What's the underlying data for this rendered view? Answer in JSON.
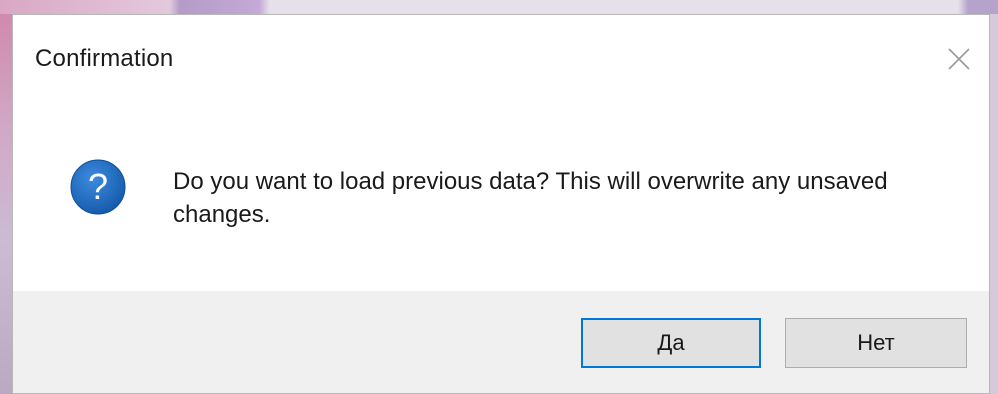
{
  "dialog": {
    "title": "Confirmation",
    "message": "Do you want to load previous data? This will overwrite any unsaved changes.",
    "icon": "question-icon",
    "buttons": {
      "yes_label": "Да",
      "no_label": "Нет"
    }
  },
  "colors": {
    "icon_blue": "#1f6fc1",
    "focus_border": "#0078d7",
    "footer_bg": "#f0f0f0"
  }
}
